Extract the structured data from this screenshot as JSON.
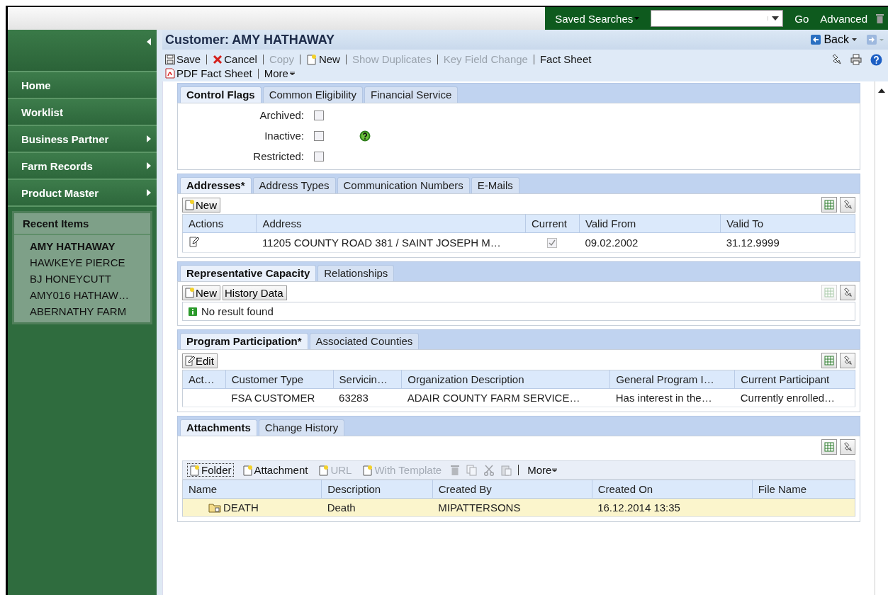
{
  "top_bar": {
    "saved_searches": "Saved Searches",
    "go": "Go",
    "advanced": "Advanced"
  },
  "sidebar": {
    "items": [
      {
        "label": "Home",
        "has_submenu": false
      },
      {
        "label": "Worklist",
        "has_submenu": false
      },
      {
        "label": "Business Partner",
        "has_submenu": true
      },
      {
        "label": "Farm Records",
        "has_submenu": true
      },
      {
        "label": "Product Master",
        "has_submenu": true
      }
    ],
    "recent_items": {
      "title": "Recent Items",
      "items": [
        {
          "label": "AMY HATHAWAY",
          "selected": true
        },
        {
          "label": "HAWKEYE PIERCE",
          "selected": false
        },
        {
          "label": "BJ HONEYCUTT",
          "selected": false
        },
        {
          "label": "AMY016 HATHAW…",
          "selected": false
        },
        {
          "label": "ABERNATHY FARM",
          "selected": false
        }
      ]
    }
  },
  "header": {
    "title": "Customer: AMY HATHAWAY",
    "back": "Back"
  },
  "toolbar": [
    [
      {
        "label": "Save",
        "kind": "save",
        "disabled": false
      },
      {
        "label": "Cancel",
        "kind": "cancel",
        "disabled": false
      },
      {
        "label": "Copy",
        "kind": "plain",
        "disabled": true
      },
      {
        "label": "New",
        "kind": "new",
        "disabled": false
      },
      {
        "label": "Show Duplicates",
        "kind": "plain",
        "disabled": true
      },
      {
        "label": "Key Field Change",
        "kind": "plain",
        "disabled": true
      },
      {
        "label": "Fact Sheet",
        "kind": "plain",
        "disabled": false
      }
    ],
    [
      {
        "label": "PDF Fact Sheet",
        "kind": "pdf",
        "disabled": false
      },
      {
        "label": "More",
        "kind": "menu",
        "disabled": false
      }
    ]
  ],
  "sections": [
    {
      "tabs": [
        {
          "label": "Control Flags",
          "selected": true
        },
        {
          "label": "Common Eligibility",
          "selected": false
        },
        {
          "label": "Financial Service",
          "selected": false
        }
      ],
      "flags": [
        {
          "label": "Archived:",
          "checked": false,
          "help": false
        },
        {
          "label": "Inactive:",
          "checked": false,
          "help": true
        },
        {
          "label": "Restricted:",
          "checked": false,
          "help": false
        }
      ]
    },
    {
      "tabs": [
        {
          "label": "Addresses*",
          "selected": true
        },
        {
          "label": "Address Types",
          "selected": false
        },
        {
          "label": "Communication Numbers",
          "selected": false
        },
        {
          "label": "E-Mails",
          "selected": false
        }
      ],
      "buttons": [
        {
          "label": "New",
          "kind": "new"
        }
      ],
      "tools": [
        {
          "kind": "export",
          "disabled": false
        },
        {
          "kind": "settings",
          "disabled": false
        }
      ],
      "table": {
        "columns": [
          "Actions",
          "Address",
          "Current",
          "Valid From",
          "Valid To"
        ],
        "rows": [
          {
            "selected": false,
            "cells": [
              {
                "kind": "edit"
              },
              {
                "kind": "text",
                "text": "11205 COUNTY ROAD 381 / SAINT JOSEPH M…"
              },
              {
                "kind": "checkbox",
                "checked": true
              },
              {
                "kind": "text",
                "text": "09.02.2002"
              },
              {
                "kind": "text",
                "text": "31.12.9999"
              }
            ]
          }
        ]
      }
    },
    {
      "tabs": [
        {
          "label": "Representative Capacity",
          "selected": true
        },
        {
          "label": "Relationships",
          "selected": false
        }
      ],
      "buttons": [
        {
          "label": "New",
          "kind": "new"
        },
        {
          "label": "History Data",
          "kind": "plain"
        }
      ],
      "tools": [
        {
          "kind": "export",
          "disabled": true
        },
        {
          "kind": "settings",
          "disabled": false
        }
      ],
      "message": "No result found"
    },
    {
      "tabs": [
        {
          "label": "Program Participation*",
          "selected": true
        },
        {
          "label": "Associated Counties",
          "selected": false
        }
      ],
      "buttons": [
        {
          "label": "Edit",
          "kind": "edit"
        }
      ],
      "tools": [
        {
          "kind": "export",
          "disabled": false
        },
        {
          "kind": "settings",
          "disabled": false
        }
      ],
      "table": {
        "columns": [
          "Act…",
          "Customer Type",
          "Servicin…",
          "Organization Description",
          "General Program I…",
          "Current Participant"
        ],
        "rows": [
          {
            "selected": false,
            "cells": [
              {
                "kind": "blank"
              },
              {
                "kind": "text",
                "text": "FSA CUSTOMER"
              },
              {
                "kind": "text",
                "text": "63283"
              },
              {
                "kind": "text",
                "text": "ADAIR COUNTY FARM SERVICE…"
              },
              {
                "kind": "text",
                "text": "Has interest in the…"
              },
              {
                "kind": "text",
                "text": "Currently enrolled…"
              }
            ]
          }
        ]
      }
    },
    {
      "tabs": [
        {
          "label": "Attachments",
          "selected": true
        },
        {
          "label": "Change History",
          "selected": false
        }
      ],
      "tools": [
        {
          "kind": "export",
          "disabled": false
        },
        {
          "kind": "settings",
          "disabled": false
        }
      ],
      "action_bar": [
        {
          "kind": "button",
          "label": "Folder",
          "disabled": false,
          "focused": true
        },
        {
          "kind": "button",
          "label": "Attachment",
          "disabled": false,
          "focused": false
        },
        {
          "kind": "button",
          "label": "URL",
          "disabled": true,
          "focused": false
        },
        {
          "kind": "button",
          "label": "With Template",
          "disabled": true,
          "focused": false
        },
        {
          "kind": "trash",
          "disabled": true
        },
        {
          "kind": "copy",
          "disabled": true
        },
        {
          "kind": "cut",
          "disabled": true
        },
        {
          "kind": "paste",
          "disabled": true
        },
        {
          "kind": "separator"
        },
        {
          "kind": "menu",
          "label": "More",
          "disabled": false
        }
      ],
      "table": {
        "columns": [
          "Name",
          "Description",
          "Created By",
          "Created On",
          "File Name"
        ],
        "rows": [
          {
            "selected": true,
            "cells": [
              {
                "kind": "folder",
                "text": "DEATH"
              },
              {
                "kind": "text",
                "text": "Death"
              },
              {
                "kind": "text",
                "text": "MIPATTERSONS"
              },
              {
                "kind": "text",
                "text": "16.12.2014 13:35"
              },
              {
                "kind": "blank"
              }
            ]
          }
        ]
      }
    }
  ]
}
